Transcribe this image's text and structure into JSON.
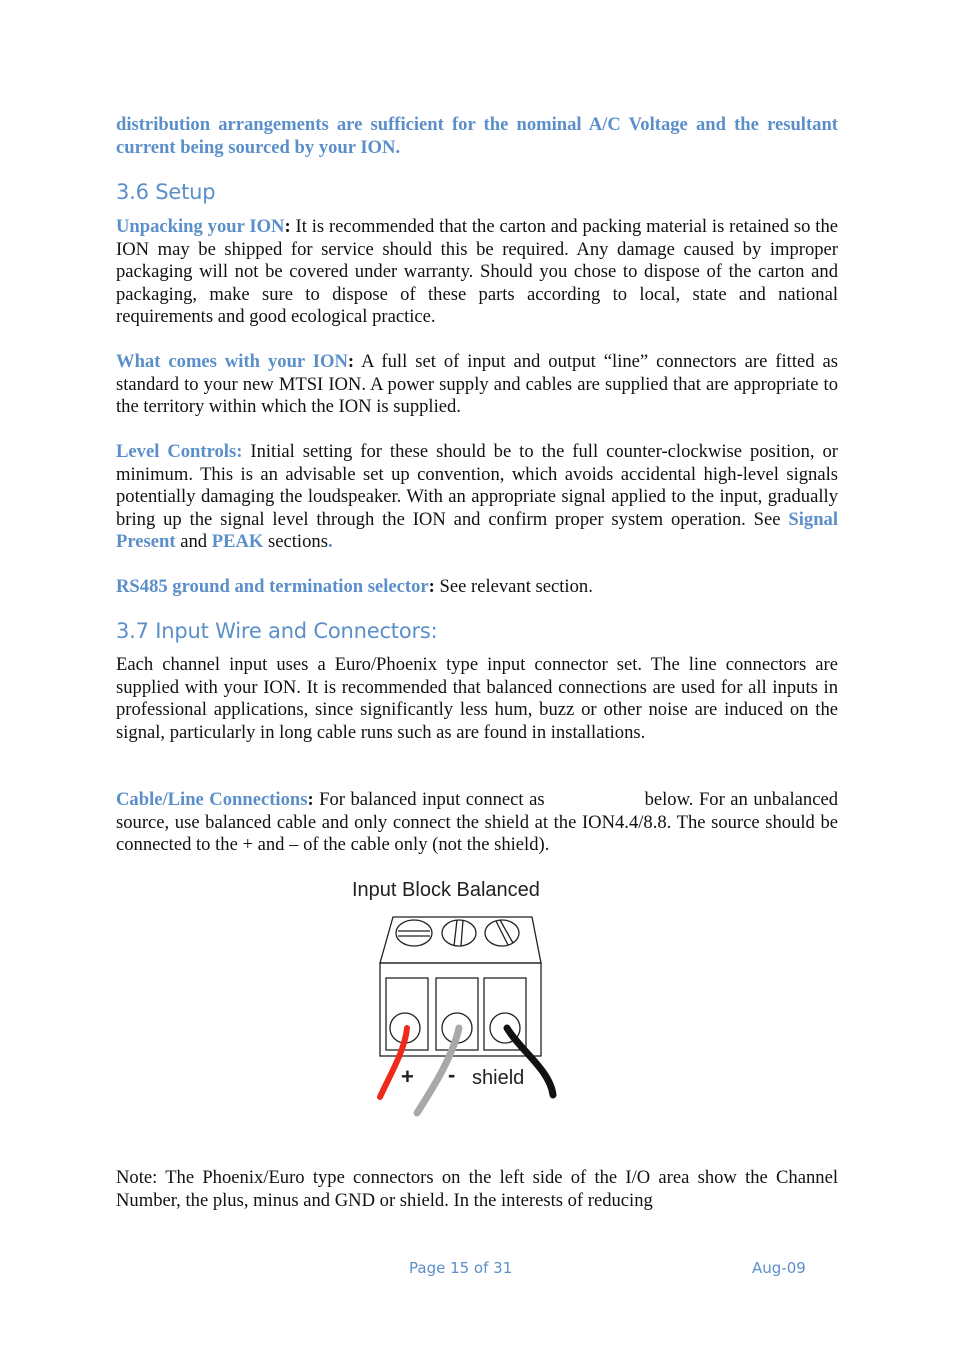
{
  "intro": {
    "text": "distribution arrangements are sufficient for the nominal A/C Voltage and the resultant current being sourced by your ION."
  },
  "section_36": {
    "heading": "3.6  Setup",
    "unpacking": {
      "label": "Unpacking your ION",
      "colon": ":",
      "text": " It is recommended that the carton and packing material is retained so the ION may be shipped for service should this be required. Any damage caused by improper packaging will not be covered under warranty.  Should you chose to dispose of the carton and packaging, make sure to dispose of these parts according to local, state and national requirements and good ecological practice."
    },
    "what_comes": {
      "label": "What comes with your ION",
      "colon": ":",
      "text": " A full set of input and output “line” connectors are fitted as standard to your new MTSI ION.  A power supply and cables are supplied that are appropriate to the territory within which the ION is supplied."
    },
    "level_controls": {
      "label": "Level Controls:",
      "text1": "  Initial setting for these should be to the full counter-clockwise position, or minimum.  This is an advisable set up convention, which avoids accidental high-level signals potentially damaging the loudspeaker. With an appropriate signal applied to the input, gradually bring up the signal level through the ION and confirm proper system operation.   See ",
      "link1": "Signal Present",
      "text2": " and ",
      "link2": "PEAK",
      "text3": " sections",
      "period": "."
    },
    "rs485": {
      "label": "RS485 ground and termination selector",
      "colon": ":",
      "text": " See relevant section."
    }
  },
  "section_37": {
    "heading": "3.7  Input Wire and Connectors:",
    "body": "Each channel input uses a Euro/Phoenix type input connector set.  The line connectors are supplied with your ION.   It is recommended that balanced connections are used for all inputs in professional applications, since significantly less hum, buzz or other noise are induced on the signal, particularly in long cable runs such as are found in installations.",
    "cable": {
      "label": "Cable/Line Connections",
      "colon": ":",
      "text1": " For balanced input connect as",
      "text2": "below. For an unbalanced source, use balanced cable and only connect the shield at the ION4.4/8.8. The source should be connected to the + and – of the cable only (not the shield)."
    },
    "figure": {
      "title": "Input Block Balanced",
      "labels": {
        "plus": "+",
        "minus": "-",
        "shield": "shield"
      },
      "wire_colors": {
        "plus": "#ee2a1a",
        "minus": "#a8a8a8",
        "shield": "#111111"
      }
    },
    "note": "Note: The Phoenix/Euro type connectors on the left side of the I/O area show the Channel Number, the plus, minus and GND or shield.   In the interests of reducing"
  },
  "footer": {
    "page": "Page 15 of 31",
    "date": "Aug-09"
  }
}
